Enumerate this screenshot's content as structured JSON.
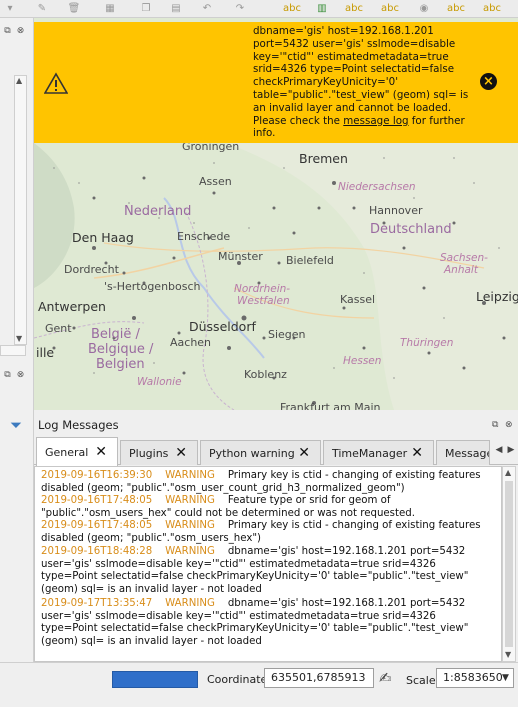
{
  "toolbar": {
    "icons": [
      "dropdown-icon",
      "edit-icon",
      "delete-icon",
      "table-icon",
      "copy-icon",
      "paste-icon",
      "undo-icon",
      "redo-icon",
      "label-abc-icon",
      "label-abc-icon",
      "label-abc-icon",
      "label-abc-icon",
      "label-abc-icon",
      "show-icon",
      "label-abc-icon",
      "label-abc-icon"
    ]
  },
  "warning": {
    "text": "dbname='gis' host=192.168.1.201 port=5432 user='gis' sslmode=disable key='\"ctid\"' estimatedmetadata=true srid=4326 type=Point selectatid=false checkPrimaryKeyUnicity='0' table=\"public\".\"test_view\" (geom) sql= is an invalid layer and cannot be loaded. Please check the ",
    "link": "message log",
    "tail": " for further info.",
    "accent": "#ffc400"
  },
  "map": {
    "labels": [
      {
        "text": "Groningen",
        "cls": "city"
      },
      {
        "text": "Bremen",
        "cls": "big"
      },
      {
        "text": "Assen",
        "cls": "city"
      },
      {
        "text": "Niedersachsen",
        "cls": "region"
      },
      {
        "text": "Nederland",
        "cls": "country"
      },
      {
        "text": "Deutschland",
        "cls": "country"
      },
      {
        "text": "Den Haag",
        "cls": "big"
      },
      {
        "text": "Enschede",
        "cls": "city"
      },
      {
        "text": "Hannover",
        "cls": "city"
      },
      {
        "text": "Münster",
        "cls": "city"
      },
      {
        "text": "Bielefeld",
        "cls": "city"
      },
      {
        "text": "Sachsen-",
        "cls": "region"
      },
      {
        "text": "Anhalt",
        "cls": "region"
      },
      {
        "text": "Dordrecht",
        "cls": "city"
      },
      {
        "text": "'s-Hertogenbosch",
        "cls": "city"
      },
      {
        "text": "Nordrhein-",
        "cls": "region"
      },
      {
        "text": "Westfalen",
        "cls": "region"
      },
      {
        "text": "Kassel",
        "cls": "city"
      },
      {
        "text": "Antwerpen",
        "cls": "big"
      },
      {
        "text": "Leipzig",
        "cls": "big"
      },
      {
        "text": "Gent",
        "cls": "city"
      },
      {
        "text": "Düsseldorf",
        "cls": "big"
      },
      {
        "text": "Siegen",
        "cls": "city"
      },
      {
        "text": "België /",
        "cls": "country"
      },
      {
        "text": "Belgique /",
        "cls": "country"
      },
      {
        "text": "Belgien",
        "cls": "country"
      },
      {
        "text": "Aachen",
        "cls": "city"
      },
      {
        "text": "Thüringen",
        "cls": "region"
      },
      {
        "text": "ille",
        "cls": "big"
      },
      {
        "text": "Hessen",
        "cls": "region"
      },
      {
        "text": "Koblenz",
        "cls": "city"
      },
      {
        "text": "Wallonie",
        "cls": "region"
      },
      {
        "text": "Frankfurt am Main",
        "cls": "city"
      }
    ]
  },
  "log": {
    "title": "Log Messages",
    "tabs": [
      "General",
      "Plugins",
      "Python warning",
      "TimeManager",
      "Message"
    ],
    "active_tab": "General",
    "entries": [
      {
        "time": "2019-09-16T16:39:30",
        "level": "WARNING",
        "msg": "Primary key is ctid - changing of existing features disabled (geom; \"public\".\"osm_user_count_grid_h3_normalized_geom\")"
      },
      {
        "time": "2019-09-16T17:48:05",
        "level": "WARNING",
        "msg": "Feature type or srid for geom of \"public\".\"osm_users_hex\" could not be determined or was not requested."
      },
      {
        "time": "2019-09-16T17:48:05",
        "level": "WARNING",
        "msg": "Primary key is ctid - changing of existing features disabled (geom; \"public\".\"osm_users_hex\")"
      },
      {
        "time": "2019-09-16T18:48:28",
        "level": "WARNING",
        "msg": "dbname='gis' host=192.168.1.201 port=5432 user='gis' sslmode=disable key='\"ctid\"' estimatedmetadata=true srid=4326 type=Point selectatid=false checkPrimaryKeyUnicity='0' table=\"public\".\"test_view\" (geom) sql= is an invalid layer - not loaded"
      },
      {
        "time": "2019-09-17T13:35:47",
        "level": "WARNING",
        "msg": "dbname='gis' host=192.168.1.201 port=5432 user='gis' sslmode=disable key='\"ctid\"' estimatedmetadata=true srid=4326 type=Point selectatid=false checkPrimaryKeyUnicity='0' table=\"public\".\"test_view\" (geom) sql= is an invalid layer - not loaded"
      }
    ]
  },
  "status": {
    "coordinate_label": "Coordinate",
    "coordinate_value": "635501,6785913",
    "scale_label": "Scale",
    "scale_value": "1:8583650",
    "progress_color": "#2f6fc9"
  }
}
